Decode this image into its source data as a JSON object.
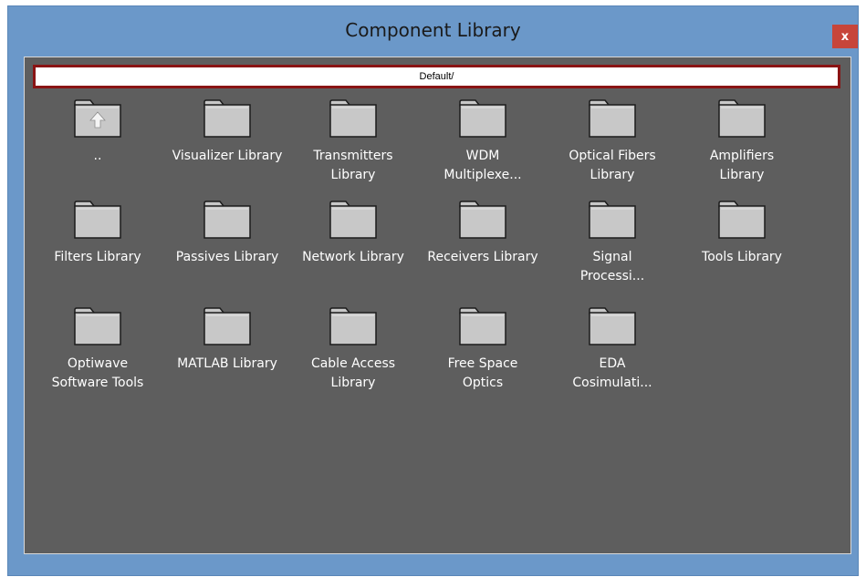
{
  "window": {
    "title": "Component Library",
    "close_label": "x"
  },
  "path": "Default/",
  "items": [
    {
      "label": "..",
      "icon": "folder-up-icon"
    },
    {
      "label": "Visualizer Library",
      "icon": "folder-icon"
    },
    {
      "label": "Transmitters\nLibrary",
      "icon": "folder-icon"
    },
    {
      "label": "WDM\nMultiplexe...",
      "icon": "folder-icon"
    },
    {
      "label": "Optical Fibers\nLibrary",
      "icon": "folder-icon"
    },
    {
      "label": "Amplifiers\nLibrary",
      "icon": "folder-icon"
    },
    {
      "label": "Filters Library",
      "icon": "folder-icon"
    },
    {
      "label": "Passives Library",
      "icon": "folder-icon"
    },
    {
      "label": "Network Library",
      "icon": "folder-icon"
    },
    {
      "label": "Receivers Library",
      "icon": "folder-icon"
    },
    {
      "label": "Signal\nProcessi...",
      "icon": "folder-icon"
    },
    {
      "label": "Tools Library",
      "icon": "folder-icon"
    },
    {
      "label": "Optiwave\nSoftware Tools",
      "icon": "folder-icon"
    },
    {
      "label": "MATLAB Library",
      "icon": "folder-icon"
    },
    {
      "label": "Cable Access\nLibrary",
      "icon": "folder-icon"
    },
    {
      "label": "Free Space\nOptics",
      "icon": "folder-icon"
    },
    {
      "label": "EDA\nCosimulati...",
      "icon": "folder-icon"
    }
  ],
  "colors": {
    "frame": "#6b98c9",
    "content_bg": "#5e5e5e",
    "path_border": "#8a1414",
    "close_bg": "#c7453a",
    "folder_fill": "#c8c8c8"
  }
}
